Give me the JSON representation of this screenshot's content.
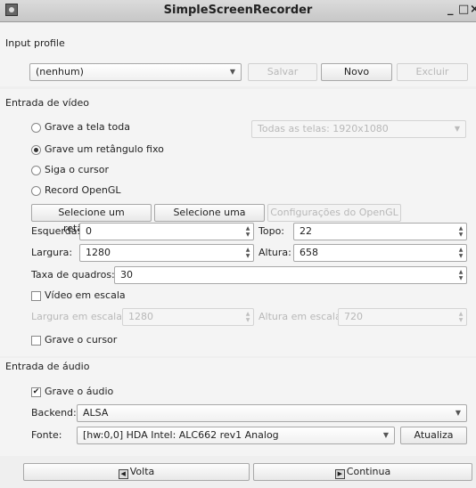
{
  "window": {
    "title": "SimpleScreenRecorder",
    "controls": [
      "_",
      "□",
      "×"
    ]
  },
  "input_profile": {
    "section_label": "Input profile",
    "profile_value": "(nenhum)",
    "save_label": "Salvar",
    "new_label": "Novo",
    "delete_label": "Excluir"
  },
  "video": {
    "section_label": "Entrada de vídeo",
    "options": [
      {
        "label": "Grave a tela toda",
        "selected": false
      },
      {
        "label": "Grave um retângulo fixo",
        "selected": true
      },
      {
        "label": "Siga o cursor",
        "selected": false
      },
      {
        "label": "Record OpenGL",
        "selected": false
      }
    ],
    "screen_select": "Todas as telas: 1920x1080",
    "select_rect_label": "Selecione um retângulo...",
    "select_window_label": "Selecione uma janela...",
    "opengl_settings_label": "Configurações do OpenGL ...",
    "left_label": "Esquerda:",
    "left_value": "0",
    "top_label": "Topo:",
    "top_value": "22",
    "width_label": "Largura:",
    "width_value": "1280",
    "height_label": "Altura:",
    "height_value": "658",
    "fps_label": "Taxa de quadros:",
    "fps_value": "30",
    "scale_label": "Vídeo em escala",
    "scale_checked": false,
    "scale_width_label": "Largura em escala:",
    "scale_width_value": "1280",
    "scale_height_label": "Altura em escala:",
    "scale_height_value": "720",
    "record_cursor_label": "Grave o cursor",
    "record_cursor_checked": false
  },
  "audio": {
    "section_label": "Entrada de áudio",
    "record_audio_label": "Grave o áudio",
    "record_audio_checked": true,
    "backend_label": "Backend:",
    "backend_value": "ALSA",
    "source_label": "Fonte:",
    "source_value": "[hw:0,0] HDA Intel: ALC662 rev1 Analog",
    "refresh_label": "Atualiza"
  },
  "footer": {
    "back_label": "Volta",
    "continue_label": "Continua"
  }
}
